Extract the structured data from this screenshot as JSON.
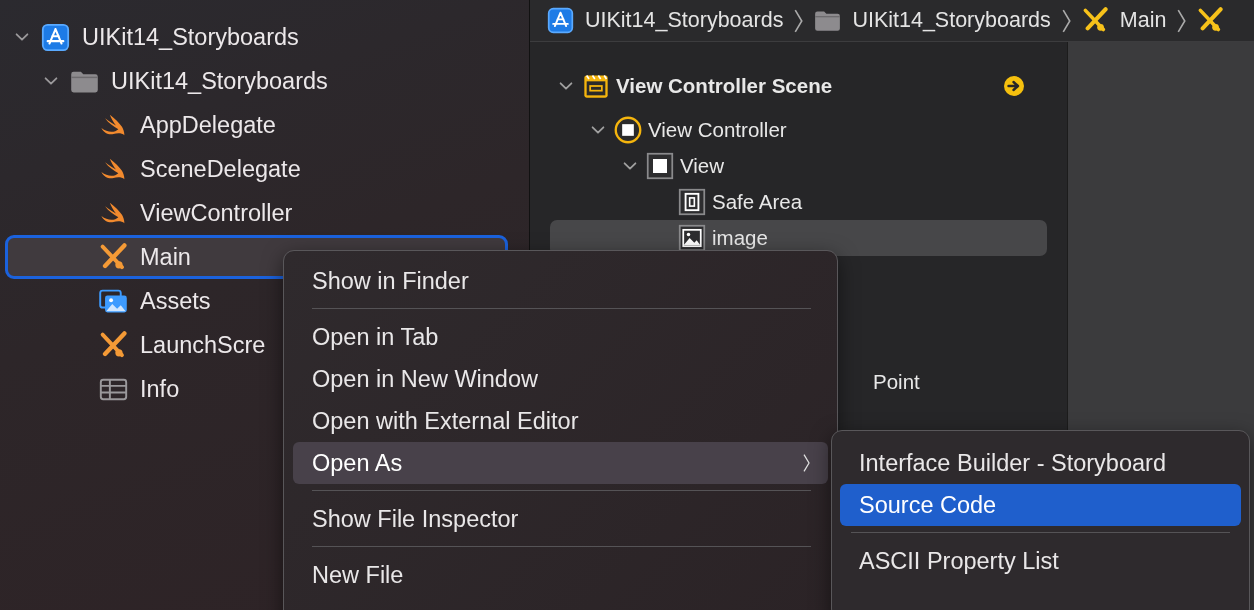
{
  "navigator": {
    "items": [
      {
        "label": "UIKit14_Storyboards",
        "kind": "project",
        "expanded": true,
        "selected": false,
        "children": [
          {
            "label": "UIKit14_Storyboards",
            "kind": "folder",
            "expanded": true,
            "selected": false,
            "children": [
              {
                "label": "AppDelegate",
                "kind": "swift",
                "selected": false
              },
              {
                "label": "SceneDelegate",
                "kind": "swift",
                "selected": false
              },
              {
                "label": "ViewController",
                "kind": "swift",
                "selected": false
              },
              {
                "label": "Main",
                "kind": "storyboard",
                "selected": true
              },
              {
                "label": "Assets",
                "kind": "assets",
                "selected": false
              },
              {
                "label": "LaunchScre",
                "kind": "storyboard",
                "selected": false
              },
              {
                "label": "Info",
                "kind": "plist",
                "selected": false
              }
            ]
          }
        ]
      }
    ]
  },
  "jump_bar": {
    "items": [
      {
        "label": "UIKit14_Storyboards",
        "kind": "project"
      },
      {
        "label": "UIKit14_Storyboards",
        "kind": "folder"
      },
      {
        "label": "Main",
        "kind": "storyboard"
      },
      {
        "kind": "storyboard"
      }
    ]
  },
  "outline": {
    "items": [
      {
        "label": "View Controller Scene",
        "kind": "scene",
        "expanded": true,
        "selected": false,
        "children": [
          {
            "label": "View Controller",
            "kind": "controller",
            "expanded": true,
            "selected": false,
            "children": [
              {
                "label": "View",
                "kind": "view",
                "expanded": true,
                "selected": false,
                "children": [
                  {
                    "label": "Safe Area",
                    "kind": "safe-area",
                    "selected": false
                  },
                  {
                    "label": "image",
                    "kind": "image",
                    "selected": true
                  },
                  {
                    "label": "Point",
                    "kind": "partial",
                    "selected": false
                  }
                ]
              }
            ]
          }
        ]
      }
    ]
  },
  "context_menu": {
    "items": [
      {
        "label": "Show in Finder",
        "kind": "item",
        "selected": false
      },
      {
        "kind": "separator"
      },
      {
        "label": "Open in Tab",
        "kind": "item",
        "selected": false
      },
      {
        "label": "Open in New Window",
        "kind": "item",
        "selected": false
      },
      {
        "label": "Open with External Editor",
        "kind": "item",
        "selected": false
      },
      {
        "label": "Open As",
        "kind": "submenu",
        "selected": true
      },
      {
        "kind": "separator"
      },
      {
        "label": "Show File Inspector",
        "kind": "item",
        "selected": false
      },
      {
        "kind": "separator"
      },
      {
        "label": "New File",
        "kind": "item",
        "selected": false
      }
    ]
  },
  "submenu": {
    "items": [
      {
        "label": "Interface Builder - Storyboard",
        "kind": "item",
        "selected": false
      },
      {
        "label": "Source Code",
        "kind": "item",
        "selected": true
      },
      {
        "kind": "separator"
      },
      {
        "label": "ASCII Property List",
        "kind": "item",
        "selected": false
      }
    ]
  }
}
